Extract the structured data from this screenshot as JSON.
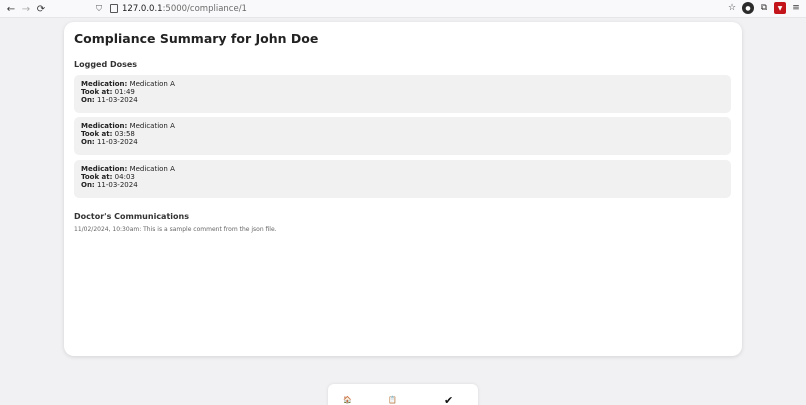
{
  "browser": {
    "url_host": "127.0.0.1",
    "url_path": ":5000/compliance/1"
  },
  "page": {
    "title": "Compliance Summary for John Doe",
    "logged_doses_heading": "Logged Doses",
    "labels": {
      "medication": "Medication:",
      "took_at": "Took at:",
      "on": "On:"
    },
    "doses": [
      {
        "medication": "Medication A",
        "took_at": "01:49",
        "on": "11-03-2024"
      },
      {
        "medication": "Medication A",
        "took_at": "03:58",
        "on": "11-03-2024"
      },
      {
        "medication": "Medication A",
        "took_at": "04:03",
        "on": "11-03-2024"
      }
    ],
    "communications_heading": "Doctor's Communications",
    "communication_text": "11/02/2024, 10:30am: This is a sample comment from the json file."
  },
  "bottom_nav": {
    "home_icon": "🏠",
    "log_icon": "📋",
    "compliance_icon": "✔"
  }
}
